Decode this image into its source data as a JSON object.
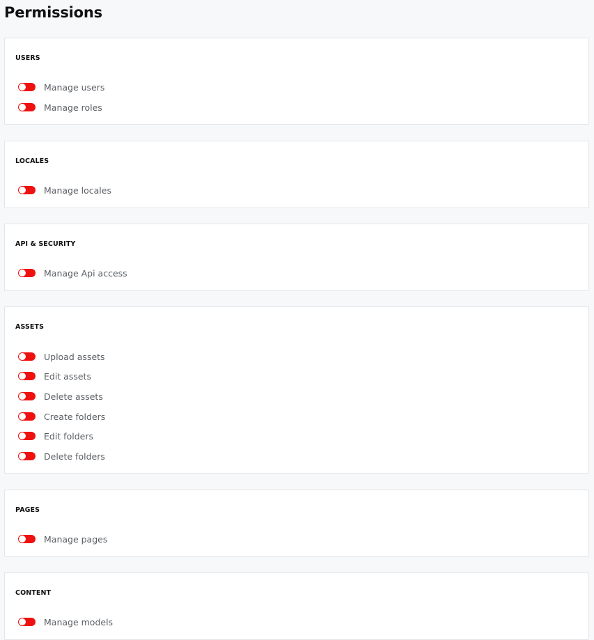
{
  "page": {
    "title": "Permissions"
  },
  "colors": {
    "toggle_off": "#ee1111",
    "card_bg": "#ffffff",
    "page_bg": "#f7f8fa"
  },
  "sections": [
    {
      "title": "USERS",
      "items": [
        "Manage users",
        "Manage roles"
      ]
    },
    {
      "title": "LOCALES",
      "items": [
        "Manage locales"
      ]
    },
    {
      "title": "API & SECURITY",
      "items": [
        "Manage Api access"
      ]
    },
    {
      "title": "ASSETS",
      "items": [
        "Upload assets",
        "Edit assets",
        "Delete assets",
        "Create folders",
        "Edit folders",
        "Delete folders"
      ]
    },
    {
      "title": "PAGES",
      "items": [
        "Manage pages"
      ]
    },
    {
      "title": "CONTENT",
      "items": [
        "Manage models"
      ]
    }
  ]
}
